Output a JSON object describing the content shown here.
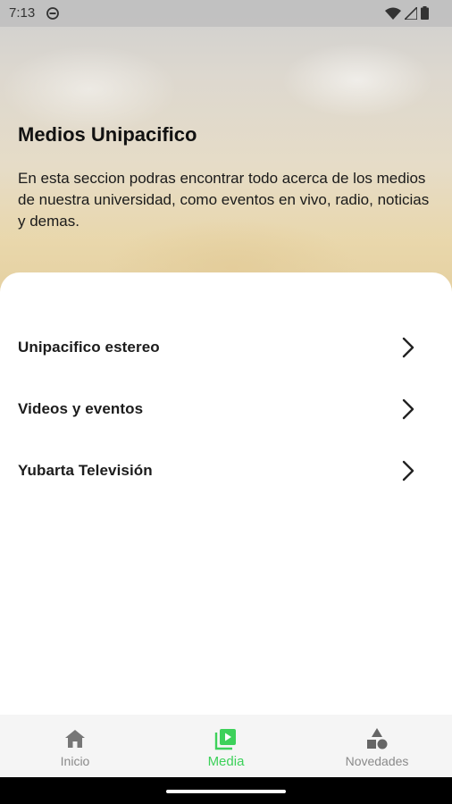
{
  "status_bar": {
    "time": "7:13"
  },
  "hero": {
    "title": "Medios Unipacifico",
    "description": "En esta seccion podras encontrar todo acerca de los medios de nuestra universidad, como eventos en vivo, radio, noticias y demas."
  },
  "menu": {
    "items": [
      {
        "label": "Unipacifico estereo"
      },
      {
        "label": "Videos y eventos"
      },
      {
        "label": "Yubarta Televisión"
      }
    ]
  },
  "bottom_nav": {
    "items": [
      {
        "label": "Inicio",
        "icon": "home-icon"
      },
      {
        "label": "Media",
        "icon": "media-play-icon"
      },
      {
        "label": "Novedades",
        "icon": "shapes-icon"
      }
    ],
    "active": "Media",
    "active_color": "#3dd15a",
    "inactive_color": "#8a8a8a"
  }
}
